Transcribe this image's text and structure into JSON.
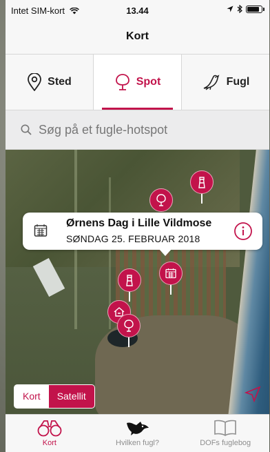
{
  "status_bar": {
    "carrier": "Intet SIM-kort",
    "time": "13.44",
    "battery_level": 0.9
  },
  "nav": {
    "title": "Kort"
  },
  "segments": [
    {
      "label": "Sted",
      "icon": "location-pin-icon",
      "active": false
    },
    {
      "label": "Spot",
      "icon": "tree-icon",
      "active": true
    },
    {
      "label": "Fugl",
      "icon": "bird-icon",
      "active": false
    }
  ],
  "search": {
    "placeholder": "Søg på et fugle-hotspot"
  },
  "callout": {
    "title": "Ørnens Dag i Lille Vildmose",
    "date": "SØNDAG 25. FEBRUAR 2018"
  },
  "map_toggle": {
    "map_label": "Kort",
    "satellite_label": "Satellit",
    "selected": "Satellit"
  },
  "tab_bar": [
    {
      "label": "Kort",
      "icon": "binoculars-icon",
      "active": true
    },
    {
      "label": "Hvilken fugl?",
      "icon": "bird-silhouette-icon",
      "active": false
    },
    {
      "label": "DOFs fuglebog",
      "icon": "open-book-icon",
      "active": false
    }
  ],
  "colors": {
    "accent": "#c2134b",
    "inactive": "#8e8e8e",
    "bar_bg": "#f7f7f7"
  }
}
